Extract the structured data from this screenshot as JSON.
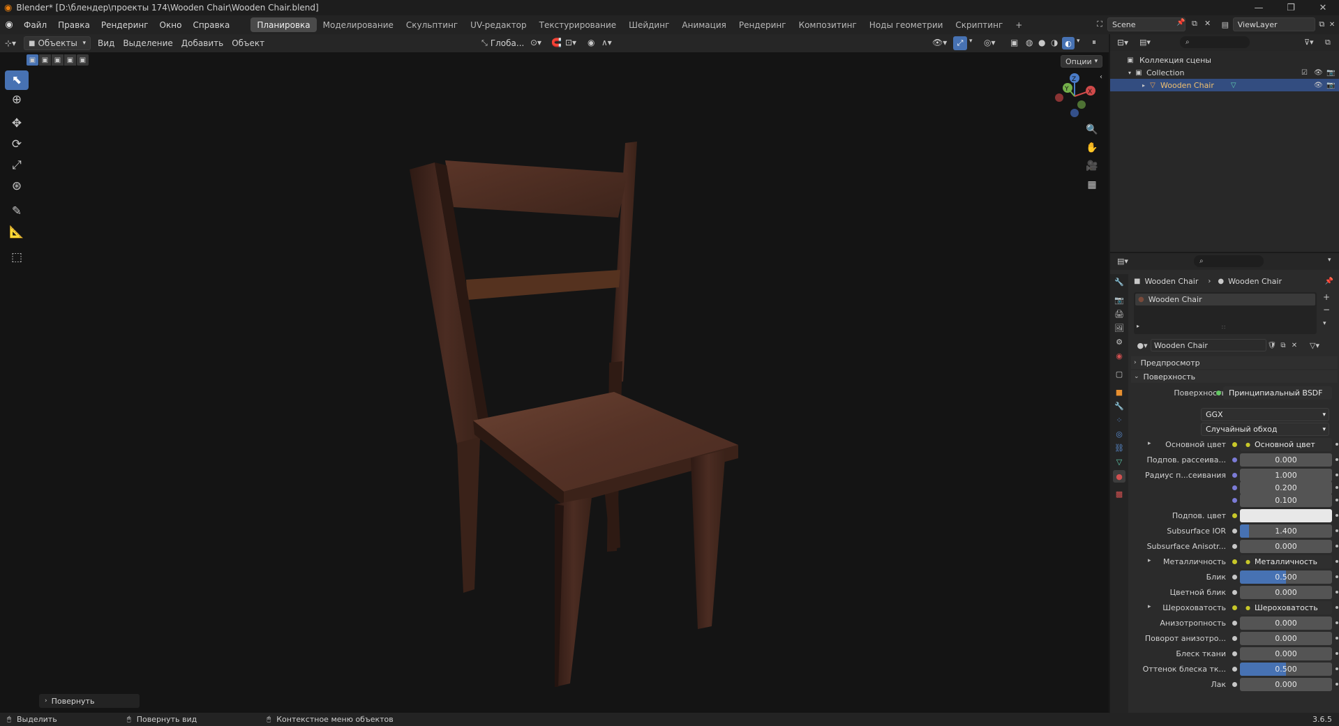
{
  "window": {
    "title": "Blender* [D:\\блендер\\проекты 174\\Wooden Chair\\Wooden Chair.blend]",
    "minimize": "—",
    "maximize": "❐",
    "close": "✕"
  },
  "menu": [
    "Файл",
    "Правка",
    "Рендеринг",
    "Окно",
    "Справка"
  ],
  "workspaces": [
    "Планировка",
    "Моделирование",
    "Скульптинг",
    "UV-редактор",
    "Текстурирование",
    "Шейдинг",
    "Анимация",
    "Рендеринг",
    "Композитинг",
    "Ноды геометрии",
    "Скриптинг"
  ],
  "workspace_add": "+",
  "scene": {
    "name": "Scene",
    "view_layer": "ViewLayer"
  },
  "viewport_header": {
    "mode": "Объекты",
    "menus": [
      "Вид",
      "Выделение",
      "Добавить",
      "Объект"
    ],
    "orientation": "Глоба...",
    "options": "Опции"
  },
  "gizmo": {
    "x": "X",
    "y": "Y",
    "z": "Z"
  },
  "last_op": "Повернуть",
  "outliner": {
    "scene_collection": "Коллекция сцены",
    "collection": "Collection",
    "object": "Wooden Chair"
  },
  "properties": {
    "breadcrumb_object": "Wooden Chair",
    "breadcrumb_material": "Wooden Chair",
    "slot_name": "Wooden Chair",
    "material_name": "Wooden Chair",
    "panel_preview": "Предпросмотр",
    "panel_surface": "Поверхность",
    "surface_label": "Поверхность",
    "surface_value": "Принципиальный BSDF",
    "distribution": "GGX",
    "subsurface_method": "Случайный обход",
    "rows": [
      {
        "label": "Основной цвет",
        "value": "Основной цвет",
        "kind": "link",
        "expand": true
      },
      {
        "label": "Подпов. рассеива...",
        "value": "0.000",
        "fill": 0
      },
      {
        "label": "Радиус п...сеивания",
        "value": "1.000",
        "fill": 0
      },
      {
        "label": "",
        "value": "0.200",
        "fill": 0
      },
      {
        "label": "",
        "value": "0.100",
        "fill": 0
      },
      {
        "label": "Подпов. цвет",
        "value": "",
        "kind": "color"
      },
      {
        "label": "Subsurface IOR",
        "value": "1.400",
        "fill": 0.1
      },
      {
        "label": "Subsurface Anisotr...",
        "value": "0.000",
        "fill": 0
      },
      {
        "label": "Металличность",
        "value": "Металличность",
        "kind": "link",
        "expand": true
      },
      {
        "label": "Блик",
        "value": "0.500",
        "fill": 0.5
      },
      {
        "label": "Цветной блик",
        "value": "0.000",
        "fill": 0
      },
      {
        "label": "Шероховатость",
        "value": "Шероховатость",
        "kind": "link",
        "expand": true
      },
      {
        "label": "Анизотропность",
        "value": "0.000",
        "fill": 0
      },
      {
        "label": "Поворот анизотро...",
        "value": "0.000",
        "fill": 0
      },
      {
        "label": "Блеск ткани",
        "value": "0.000",
        "fill": 0
      },
      {
        "label": "Оттенок блеска тк...",
        "value": "0.500",
        "fill": 0.5
      },
      {
        "label": "Лак",
        "value": "0.000",
        "fill": 0
      }
    ]
  },
  "status": {
    "select": "Выделить",
    "rotate_view": "Повернуть вид",
    "context_menu": "Контекстное меню объектов",
    "version": "3.6.5"
  },
  "colors": {
    "accent": "#4772b3",
    "background": "#141414",
    "wood_dark": "#3a2219",
    "wood_light": "#6b4030"
  }
}
